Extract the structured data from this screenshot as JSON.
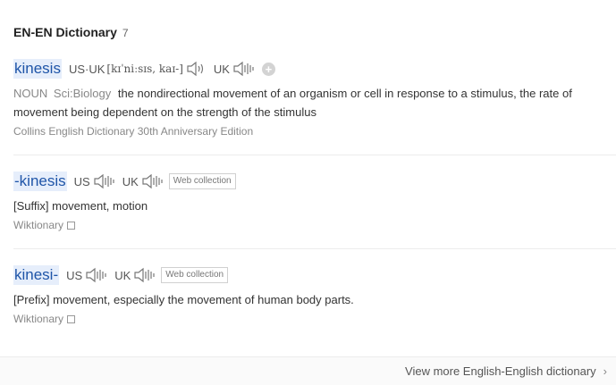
{
  "header": {
    "title": "EN-EN Dictionary",
    "count": "7"
  },
  "entries": [
    {
      "word": "kinesis",
      "us_label": "US·UK",
      "ipa": "[kɪˈniːsɪs, kaɪ-]",
      "uk_label": "UK",
      "pos": "NOUN",
      "subject": "Sci:Biology",
      "definition": "the nondirectional movement of an organism or cell in response to a stimulus, the rate of movement being dependent on the strength of the stimulus",
      "source": "Collins English Dictionary 30th Anniversary Edition"
    },
    {
      "word": "-kinesis",
      "us_label": "US",
      "uk_label": "UK",
      "tag": "Web collection",
      "definition": "[Suffix] movement, motion",
      "source": "Wiktionary"
    },
    {
      "word": "kinesi-",
      "us_label": "US",
      "uk_label": "UK",
      "tag": "Web collection",
      "definition": "[Prefix] movement, especially the movement of human body parts.",
      "source": "Wiktionary"
    }
  ],
  "footer": {
    "more_label": "View more English-English dictionary",
    "icon": "chevron-right-icon"
  },
  "icons": {
    "speaker": "speaker-icon",
    "add": "plus-icon",
    "external": "external-link-icon"
  },
  "colors": {
    "headword": "#1f55a8",
    "headword_bg": "#e6eefb",
    "muted": "#888888"
  }
}
